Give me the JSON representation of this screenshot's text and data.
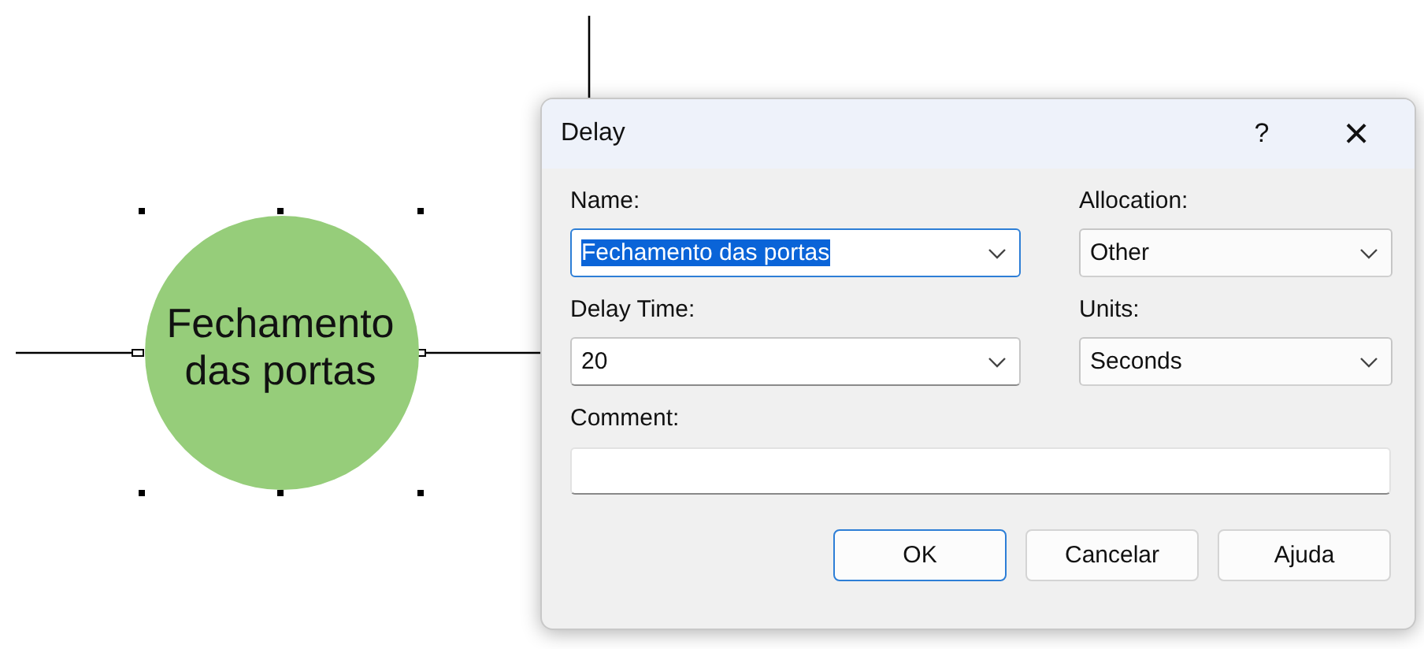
{
  "diagram": {
    "node": {
      "label": "Fechamento das portas",
      "selected": true
    }
  },
  "dialog": {
    "title": "Delay",
    "help_button": "?",
    "close_button": "×",
    "fields": [
      {
        "label": "Name:",
        "value": "Fechamento das portas",
        "text_selected": true,
        "focused": true
      },
      {
        "label": "Allocation:",
        "value": "Other",
        "text_selected": false,
        "focused": false
      },
      {
        "label": "Delay Time:",
        "value": "20",
        "text_selected": false,
        "focused": false
      },
      {
        "label": "Units:",
        "value": "Seconds",
        "text_selected": false,
        "focused": false
      }
    ],
    "comment": {
      "label": "Comment:"
    },
    "buttons": [
      {
        "label": "OK",
        "default": true
      },
      {
        "label": "Cancelar",
        "default": false
      },
      {
        "label": "Ajuda",
        "default": false
      }
    ]
  }
}
